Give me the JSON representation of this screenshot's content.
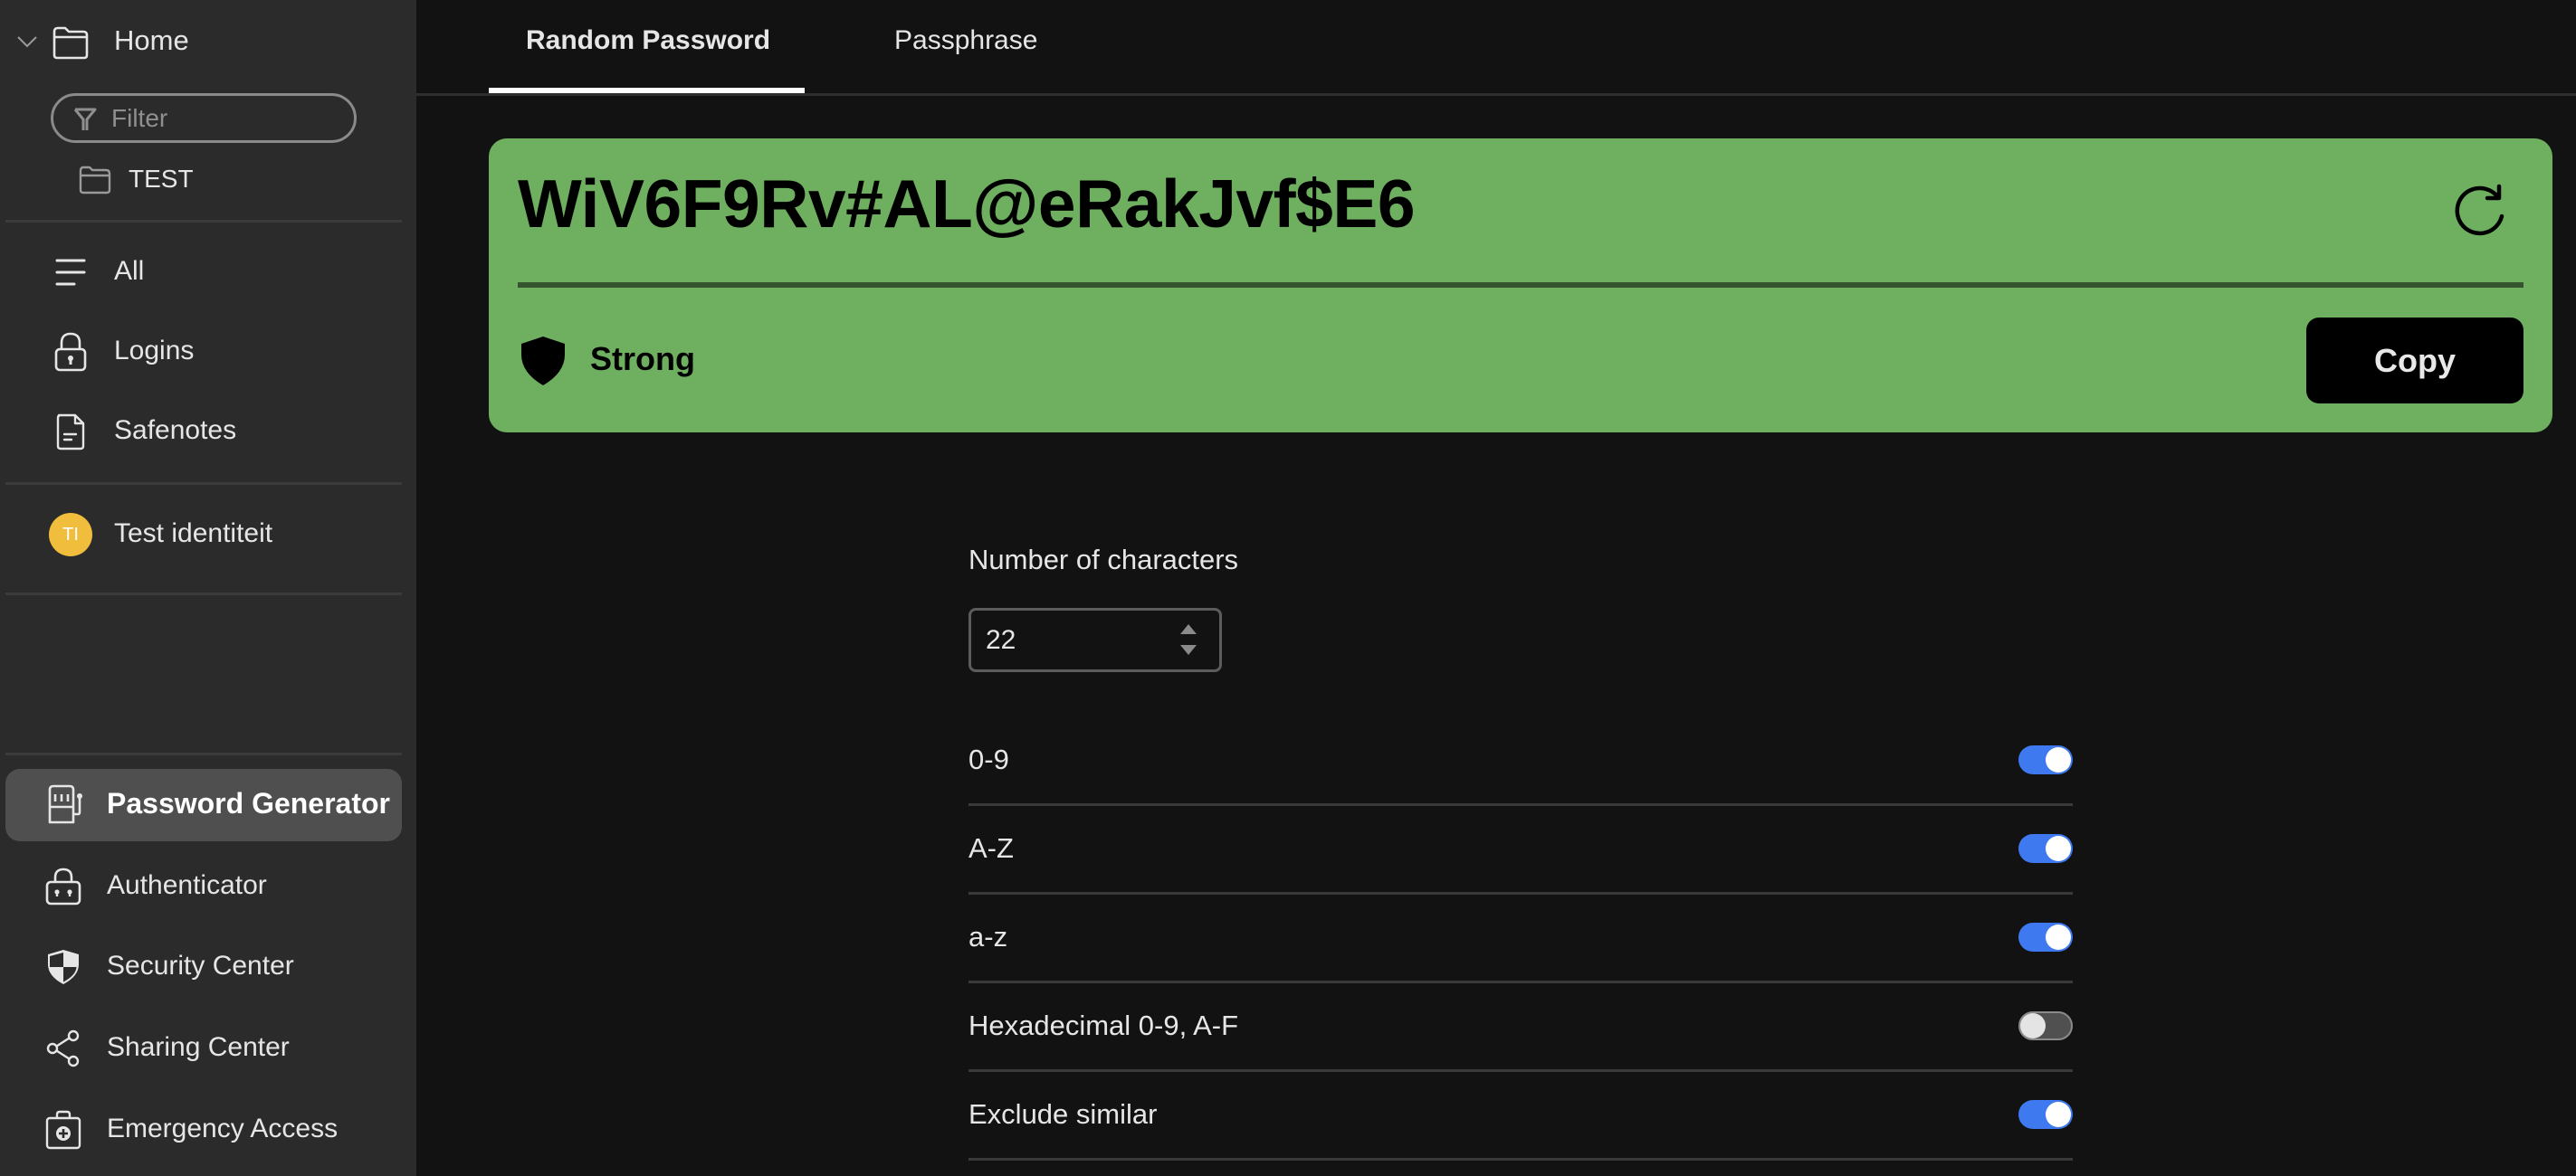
{
  "sidebar": {
    "home": {
      "label": "Home",
      "expanded": true
    },
    "filter": {
      "placeholder": "Filter",
      "value": ""
    },
    "folders": [
      {
        "label": "TEST"
      }
    ],
    "categories": [
      {
        "label": "All",
        "icon": "list-icon"
      },
      {
        "label": "Logins",
        "icon": "lock-icon"
      },
      {
        "label": "Safenotes",
        "icon": "note-icon"
      }
    ],
    "identity": {
      "initials": "TI",
      "label": "Test identiteit",
      "avatar_color": "#f0bd3c"
    },
    "tools": [
      {
        "label": "Password Generator",
        "icon": "slot-machine-icon",
        "active": true
      },
      {
        "label": "Authenticator",
        "icon": "authenticator-lock-icon",
        "active": false
      },
      {
        "label": "Security Center",
        "icon": "shield-icon",
        "active": false
      },
      {
        "label": "Sharing Center",
        "icon": "share-icon",
        "active": false
      },
      {
        "label": "Emergency Access",
        "icon": "first-aid-kit-icon",
        "active": false
      }
    ]
  },
  "tabs": [
    {
      "label": "Random Password",
      "active": true
    },
    {
      "label": "Passphrase",
      "active": false
    }
  ],
  "generator": {
    "password": "WiV6F9Rv#AL@eRakJvf$E6",
    "strength": "Strong",
    "strength_color": "#6faf60",
    "copy_label": "Copy"
  },
  "settings": {
    "length_label": "Number of characters",
    "length_value": "22",
    "options": [
      {
        "label": "0-9",
        "enabled": true
      },
      {
        "label": "A-Z",
        "enabled": true
      },
      {
        "label": "a-z",
        "enabled": true
      },
      {
        "label": "Hexadecimal 0-9, A-F",
        "enabled": false
      },
      {
        "label": "Exclude similar",
        "enabled": true
      }
    ]
  },
  "colors": {
    "toggle_on": "#3f79ef",
    "sidebar_bg": "#2b2b2b",
    "main_bg": "#121212"
  }
}
